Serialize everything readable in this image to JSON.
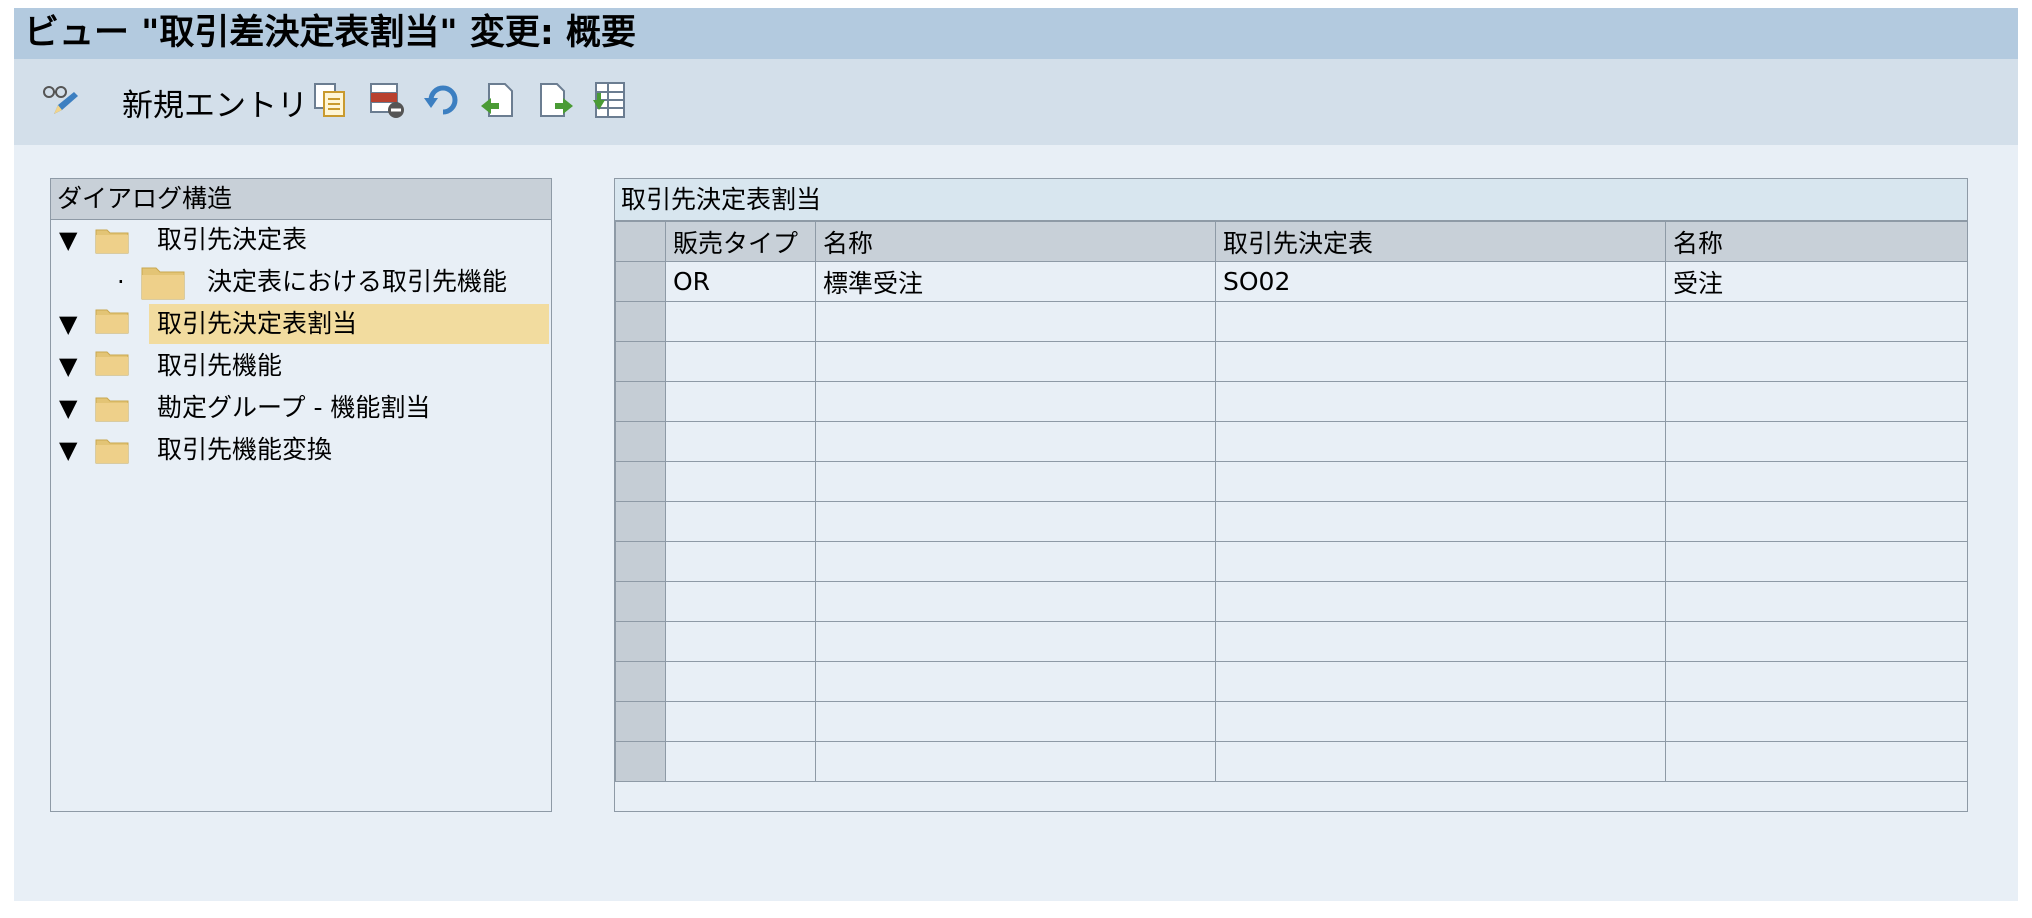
{
  "window": {
    "title": "ビュー \"取引差決定表割当\" 変更: 概要"
  },
  "toolbar": {
    "new_entry_label": "新規エントリ",
    "icons": [
      "display-change-icon",
      "copy-icon",
      "delete-icon",
      "undo-icon",
      "previous-entry-icon",
      "next-entry-icon",
      "select-block-icon"
    ]
  },
  "dialog_structure": {
    "header": "ダイアログ構造",
    "items": [
      {
        "label": "取引先決定表",
        "expander": "▼",
        "level": 0,
        "selected": false
      },
      {
        "label": "決定表における取引先機能",
        "expander": "·",
        "level": 1,
        "selected": false
      },
      {
        "label": "取引先決定表割当",
        "expander": "▼",
        "level": 0,
        "selected": true
      },
      {
        "label": "取引先機能",
        "expander": "▼",
        "level": 0,
        "selected": false
      },
      {
        "label": "勘定グループ - 機能割当",
        "expander": "▼",
        "level": 0,
        "selected": false
      },
      {
        "label": "取引先機能変換",
        "expander": "▼",
        "level": 0,
        "selected": false
      }
    ]
  },
  "table": {
    "title": "取引先決定表割当",
    "columns": [
      "販売タイプ",
      "名称",
      "取引先決定表",
      "名称"
    ],
    "rows": [
      [
        "OR",
        "標準受注",
        "SO02",
        "受注"
      ],
      [
        "",
        "",
        "",
        ""
      ],
      [
        "",
        "",
        "",
        ""
      ],
      [
        "",
        "",
        "",
        ""
      ],
      [
        "",
        "",
        "",
        ""
      ],
      [
        "",
        "",
        "",
        ""
      ],
      [
        "",
        "",
        "",
        ""
      ],
      [
        "",
        "",
        "",
        ""
      ],
      [
        "",
        "",
        "",
        ""
      ],
      [
        "",
        "",
        "",
        ""
      ],
      [
        "",
        "",
        "",
        ""
      ],
      [
        "",
        "",
        "",
        ""
      ],
      [
        "",
        "",
        "",
        ""
      ]
    ]
  },
  "colors": {
    "title_bar": "#b3cadf",
    "toolbar": "#d3dfea",
    "background": "#e8eff6",
    "selected_node": "#f2dc9f",
    "folder": "#e3c475"
  }
}
